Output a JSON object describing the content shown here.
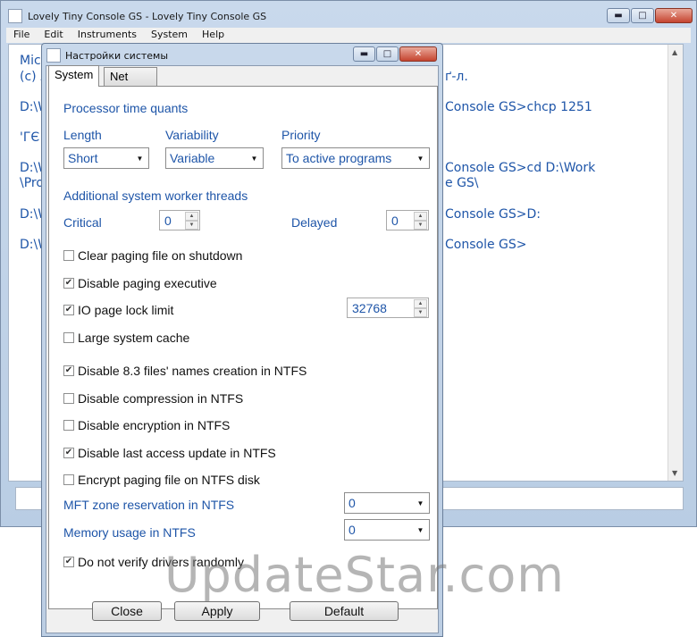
{
  "main_window": {
    "title": "Lovely Tiny Console GS - Lovely Tiny Console GS",
    "menu": [
      "File",
      "Edit",
      "Instruments",
      "System",
      "Help"
    ],
    "console_lines": [
      {
        "left": "Mic",
        "right": ""
      },
      {
        "left": "(c) Л",
        "right": "ґ-л."
      },
      {
        "left": "D:\\W",
        "right": "Console GS>chcp 1251"
      },
      {
        "left": "'ГЄ",
        "right": ""
      },
      {
        "left": "D:\\W",
        "right": "Console GS>cd D:\\Work"
      },
      {
        "left": "\\Pro",
        "right": "e GS\\"
      },
      {
        "left": "D:\\W",
        "right": "Console GS>D:"
      },
      {
        "left": "D:\\W",
        "right": "Console GS>"
      }
    ]
  },
  "dialog": {
    "title": "Настройки системы",
    "tabs": [
      "System",
      "Net"
    ],
    "processor_section": "Processor time quants",
    "length_label": "Length",
    "length_value": "Short",
    "variability_label": "Variability",
    "variability_value": "Variable",
    "priority_label": "Priority",
    "priority_value": "To active programs",
    "threads_section": "Additional system worker threads",
    "critical_label": "Critical",
    "critical_value": "0",
    "delayed_label": "Delayed",
    "delayed_value": "0",
    "checkboxes": [
      {
        "label": "Clear paging file on shutdown",
        "checked": false
      },
      {
        "label": "Disable paging executive",
        "checked": true
      },
      {
        "label": "IO page lock limit",
        "checked": true
      },
      {
        "label": "Large system cache",
        "checked": false
      },
      {
        "label": "Disable 8.3 files' names creation in NTFS",
        "checked": true
      },
      {
        "label": "Disable compression in NTFS",
        "checked": false
      },
      {
        "label": "Disable encryption in NTFS",
        "checked": false
      },
      {
        "label": "Disable last access update in NTFS",
        "checked": true
      },
      {
        "label": "Encrypt paging file on NTFS disk",
        "checked": false
      }
    ],
    "io_lock_value": "32768",
    "mft_label": "MFT zone reservation in NTFS",
    "mft_value": "0",
    "memory_label": "Memory usage in NTFS",
    "memory_value": "0",
    "verify_label": "Do not verify drivers randomly",
    "verify_checked": true,
    "buttons": {
      "close": "Close",
      "apply": "Apply",
      "default": "Default"
    }
  },
  "watermark": "UpdateStar.com",
  "colors": {
    "accent_text": "#1e55a8",
    "frame": "#bccee3",
    "close_button": "#c5442f"
  }
}
